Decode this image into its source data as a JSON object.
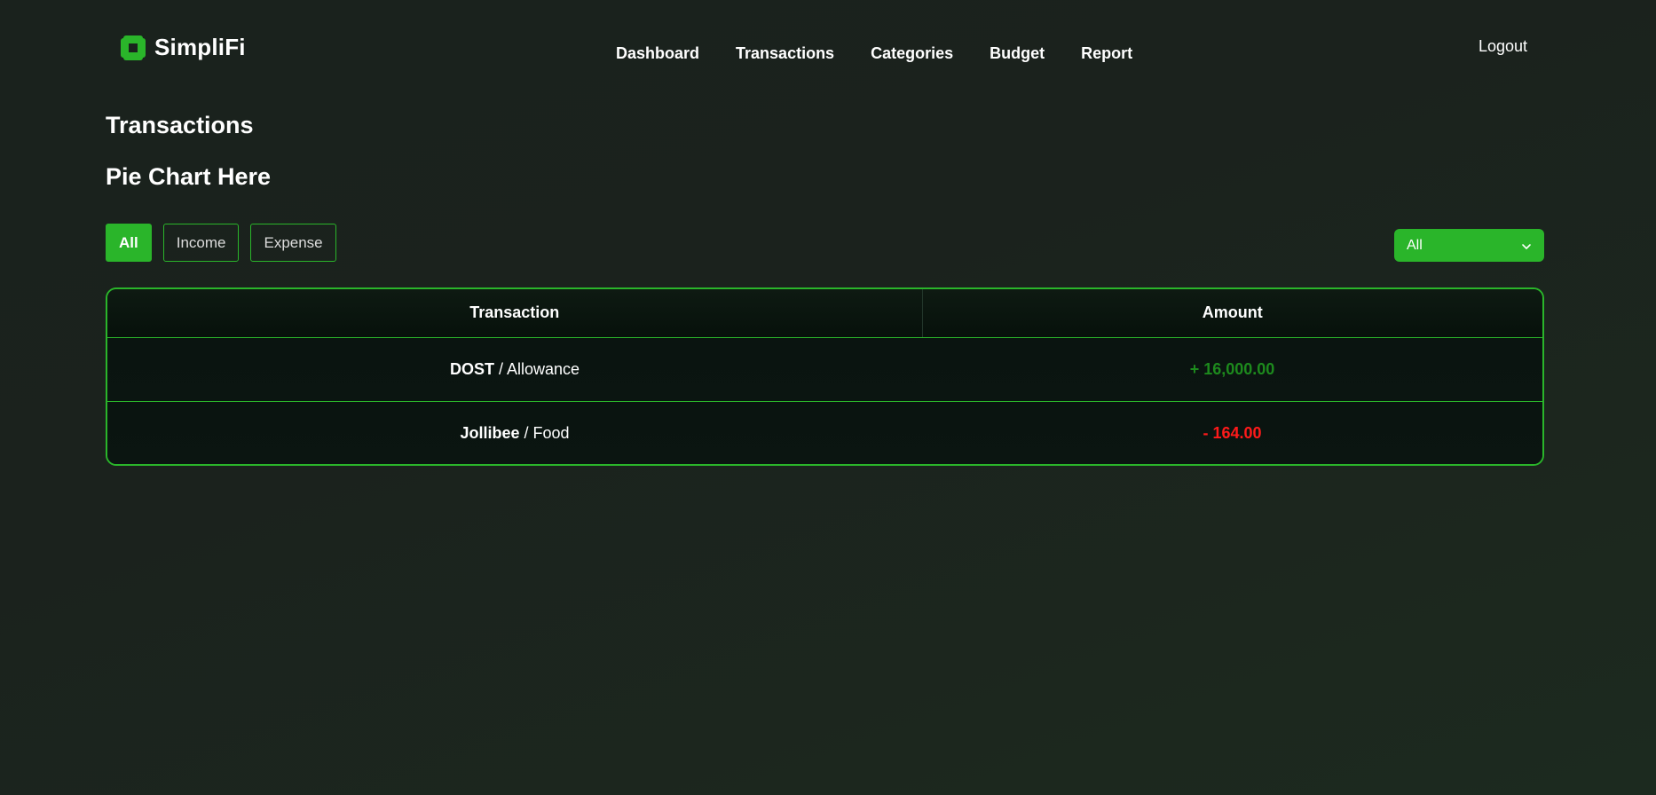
{
  "brand": {
    "name": "SimpliFi",
    "accent": "#2ab52a"
  },
  "nav": {
    "items": [
      {
        "label": "Dashboard"
      },
      {
        "label": "Transactions"
      },
      {
        "label": "Categories"
      },
      {
        "label": "Budget"
      },
      {
        "label": "Report"
      }
    ],
    "logout": "Logout"
  },
  "page": {
    "title": "Transactions",
    "section_title": "Pie Chart Here"
  },
  "filters": {
    "buttons": [
      {
        "label": "All",
        "active": true
      },
      {
        "label": "Income",
        "active": false
      },
      {
        "label": "Expense",
        "active": false
      }
    ],
    "select": {
      "value": "All"
    }
  },
  "table": {
    "headers": [
      "Transaction",
      "Amount"
    ],
    "rows": [
      {
        "merchant": "DOST",
        "separator": " / ",
        "category": "Allowance",
        "amount": "+ 16,000.00",
        "type": "income"
      },
      {
        "merchant": "Jollibee",
        "separator": " / ",
        "category": "Food",
        "amount": "- 164.00",
        "type": "expense"
      }
    ]
  },
  "colors": {
    "income": "#1d8a1d",
    "expense": "#ff1a1a",
    "background": "#1b221d"
  }
}
